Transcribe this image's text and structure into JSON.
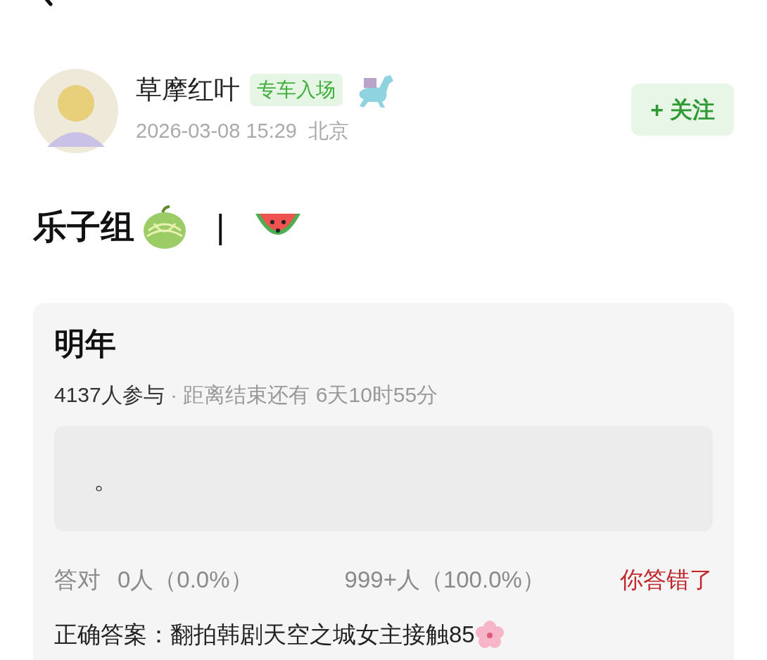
{
  "author": {
    "name": "草摩红叶",
    "badge": "专车入场",
    "time": "2026-03-08 15:29",
    "location": "北京"
  },
  "follow_button": {
    "plus": "+",
    "label": "关注"
  },
  "post": {
    "title": "乐子组",
    "separator": "|"
  },
  "poll": {
    "question": "明年",
    "participants": "4137人参与",
    "dot": "·",
    "remaining": "距离结束还有 6天10时55分",
    "option": "。",
    "correct_label": "答对",
    "correct_count": "0人（0.0%）",
    "other_count": "999+人（100.0%）",
    "result": "你答错了",
    "answer": "正确答案：翻拍韩剧天空之城女主接触85"
  }
}
